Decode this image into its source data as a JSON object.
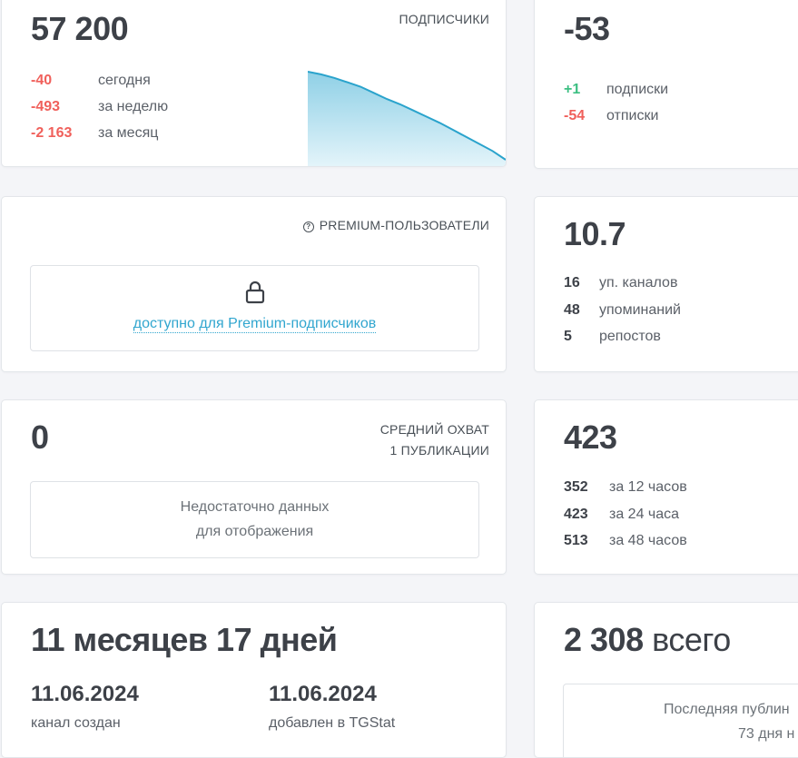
{
  "subscribers": {
    "count": "57 200",
    "label": "ПОДПИСЧИКИ",
    "rows": [
      {
        "value": "-40",
        "text": "сегодня"
      },
      {
        "value": "-493",
        "text": "за неделю"
      },
      {
        "value": "-2 163",
        "text": "за месяц"
      }
    ],
    "trend": [
      1.0,
      0.97,
      0.93,
      0.88,
      0.83,
      0.76,
      0.69,
      0.63,
      0.56,
      0.49,
      0.42,
      0.34,
      0.26,
      0.18,
      0.1,
      0.0
    ]
  },
  "today_change": {
    "count": "-53",
    "rows": [
      {
        "value": "+1",
        "text": "подписки"
      },
      {
        "value": "-54",
        "text": "отписки"
      }
    ]
  },
  "premium": {
    "label": "PREMIUM-ПОЛЬЗОВАТЕЛИ",
    "link": "доступно для Premium-подписчиков"
  },
  "citation": {
    "count": "10.7",
    "rows": [
      {
        "value": "16",
        "text": "уп. каналов"
      },
      {
        "value": "48",
        "text": "упоминаний"
      },
      {
        "value": "5",
        "text": "репостов"
      }
    ]
  },
  "avg_reach": {
    "count": "0",
    "label_line1": "СРЕДНИЙ ОХВАТ",
    "label_line2": "1 ПУБЛИКАЦИИ",
    "empty_line1": "Недостаточно данных",
    "empty_line2": "для отображения"
  },
  "views": {
    "count": "423",
    "rows": [
      {
        "value": "352",
        "text": "за 12 часов"
      },
      {
        "value": "423",
        "text": "за 24 часа"
      },
      {
        "value": "513",
        "text": "за 48 часов"
      }
    ]
  },
  "age": {
    "title": "11 месяцев 17 дней",
    "created_date": "11.06.2024",
    "created_label": "канал создан",
    "added_date": "11.06.2024",
    "added_label": "добавлен в TGStat"
  },
  "posts": {
    "count": "2 308",
    "suffix": "всего",
    "last_line1": "Последняя публин",
    "last_line2": "73 дня н"
  },
  "colors": {
    "negative": "#f0605b",
    "positive": "#3cbf82",
    "accent": "#31a6cf"
  }
}
